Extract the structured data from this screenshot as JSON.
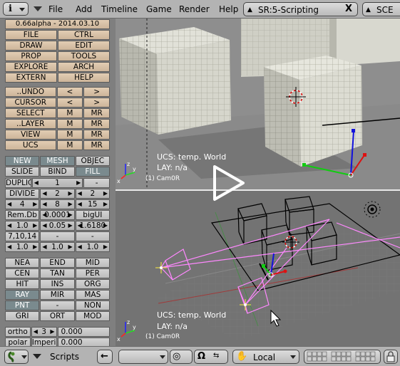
{
  "menubar": {
    "window_icon": "i",
    "menus": [
      "File",
      "Add",
      "Timeline",
      "Game",
      "Render",
      "Help"
    ],
    "screen": "SR:5-Scripting",
    "screen_close": "X",
    "scene": "SCE"
  },
  "toolbox": {
    "version": "0.66alpha - 2014.03.10",
    "rows": [
      [
        {
          "t": "FILE",
          "k": "file"
        },
        {
          "t": "CTRL",
          "k": "ctrl"
        }
      ],
      [
        {
          "t": "DRAW",
          "k": "draw"
        },
        {
          "t": "EDIT",
          "k": "edit"
        }
      ],
      [
        {
          "t": "PROP",
          "k": "prop"
        },
        {
          "t": "TOOLS",
          "k": "tools"
        }
      ],
      [
        {
          "t": "EXPLORE",
          "k": "explore"
        },
        {
          "t": "ARCH",
          "k": "arch"
        }
      ],
      [
        {
          "t": "EXTERN",
          "k": "extern"
        },
        {
          "t": "HELP",
          "k": "help"
        }
      ]
    ],
    "nav_rows": [
      [
        {
          "t": "..UNDO",
          "k": "undo",
          "w": 2
        },
        {
          "t": "<",
          "k": "undo-prev"
        },
        {
          "t": ">",
          "k": "undo-next"
        }
      ],
      [
        {
          "t": "CURSOR",
          "k": "cursor",
          "w": 2
        },
        {
          "t": "<",
          "k": "cursor-prev"
        },
        {
          "t": ">",
          "k": "cursor-next"
        }
      ],
      [
        {
          "t": "SELECT",
          "k": "select",
          "w": 2
        },
        {
          "t": "M",
          "k": "select-m"
        },
        {
          "t": "MR",
          "k": "select-mr"
        }
      ],
      [
        {
          "t": "..LAYER",
          "k": "layer",
          "w": 2
        },
        {
          "t": "M",
          "k": "layer-m"
        },
        {
          "t": "MR",
          "k": "layer-mr"
        }
      ],
      [
        {
          "t": "VIEW",
          "k": "view",
          "w": 2
        },
        {
          "t": "M",
          "k": "view-m"
        },
        {
          "t": "MR",
          "k": "view-mr"
        }
      ],
      [
        {
          "t": "UCS",
          "k": "ucs",
          "w": 2
        },
        {
          "t": "M",
          "k": "ucs-m"
        },
        {
          "t": "MR",
          "k": "ucs-mr"
        }
      ]
    ],
    "mode_rows": [
      [
        {
          "t": "NEW",
          "k": "new",
          "c": "dark"
        },
        {
          "t": "MESH",
          "k": "mesh",
          "c": "dark"
        },
        {
          "t": "OBJEC",
          "k": "objec",
          "c": "plain"
        }
      ],
      [
        {
          "t": "SLIDE",
          "k": "slide",
          "c": "plain"
        },
        {
          "t": "BIND",
          "k": "bind",
          "c": "plain"
        },
        {
          "t": "FILL",
          "k": "fill",
          "c": "dark"
        }
      ]
    ],
    "param_rows": [
      [
        {
          "t": "DUPLIC",
          "k": "duplic",
          "c": "lbl"
        },
        {
          "t": "1",
          "k": "duplic-count",
          "c": "num",
          "w": 2
        },
        {
          "t": "-",
          "k": "duplic-extra",
          "c": "plain"
        }
      ],
      [
        {
          "t": "DIVIDE",
          "k": "divide",
          "c": "lbl"
        },
        {
          "t": "2",
          "k": "divide-a",
          "c": "num"
        },
        {
          "t": "2",
          "k": "divide-b",
          "c": "num"
        }
      ],
      [
        {
          "t": "4",
          "k": "p-4",
          "c": "num"
        },
        {
          "t": "8",
          "k": "p-8",
          "c": "num"
        },
        {
          "t": "15",
          "k": "p-15",
          "c": "num"
        }
      ],
      [
        {
          "t": "Rem.Db",
          "k": "remdb",
          "c": "lbl"
        },
        {
          "t": "0.0001",
          "k": "remdb-val",
          "c": "num"
        },
        {
          "t": "bigUI",
          "k": "bigui",
          "c": "plain"
        }
      ],
      [
        {
          "t": "1.0",
          "k": "p-10a",
          "c": "num"
        },
        {
          "t": "0.05",
          "k": "p-005",
          "c": "num"
        },
        {
          "t": "1.6180",
          "k": "p-phi",
          "c": "num"
        }
      ],
      [
        {
          "t": "7,10,14",
          "k": "p-71014",
          "c": "plain"
        },
        {
          "t": "-",
          "k": "p-dash1",
          "c": "plain"
        },
        {
          "t": "-",
          "k": "p-dash2",
          "c": "plain"
        }
      ],
      [
        {
          "t": "1.0",
          "k": "p-10b",
          "c": "num"
        },
        {
          "t": "1.0",
          "k": "p-10c",
          "c": "num"
        },
        {
          "t": "1.0",
          "k": "p-10d",
          "c": "num"
        }
      ]
    ],
    "snap_rows": [
      [
        {
          "t": "NEA",
          "k": "nea"
        },
        {
          "t": "END",
          "k": "end"
        },
        {
          "t": "MID",
          "k": "mid"
        }
      ],
      [
        {
          "t": "CEN",
          "k": "cen"
        },
        {
          "t": "TAN",
          "k": "tan"
        },
        {
          "t": "PER",
          "k": "per"
        }
      ],
      [
        {
          "t": "HIT",
          "k": "hit"
        },
        {
          "t": "INS",
          "k": "ins"
        },
        {
          "t": "ORG",
          "k": "org"
        }
      ],
      [
        {
          "t": "RAY",
          "k": "ray",
          "c": "dark"
        },
        {
          "t": "MIR",
          "k": "mir"
        },
        {
          "t": "MAS",
          "k": "mas"
        }
      ],
      [
        {
          "t": "PNT",
          "k": "pnt",
          "c": "dark"
        },
        {
          "t": "-",
          "k": "snap-dash"
        },
        {
          "t": "NON",
          "k": "non"
        }
      ],
      [
        {
          "t": "GRI",
          "k": "gri"
        },
        {
          "t": "ORT",
          "k": "ort"
        },
        {
          "t": "MOD",
          "k": "mod"
        }
      ]
    ],
    "ortho": {
      "label": "ortho",
      "value": "3",
      "num": "0.000"
    },
    "polar": {
      "label": "polar",
      "value": "Imperi",
      "num": "0.000"
    }
  },
  "bottombar": {
    "scripts_label": "Scripts",
    "orientation": "Local"
  },
  "viewport_top": {
    "ucs": "UCS: temp. World",
    "lay": "LAY: n/a",
    "cam": "(1) Cam0R"
  },
  "viewport_bottom": {
    "ucs": "UCS: temp. World",
    "lay": "LAY: n/a",
    "cam": "(1) Cam0R"
  },
  "colors": {
    "button": "#d7c1a6",
    "button_dark": "#7a8a8e",
    "header": "#b3b3b3",
    "camera": "#ff8cff",
    "axis_x": "#e01010",
    "axis_y": "#10d010",
    "axis_z": "#1010e0"
  }
}
